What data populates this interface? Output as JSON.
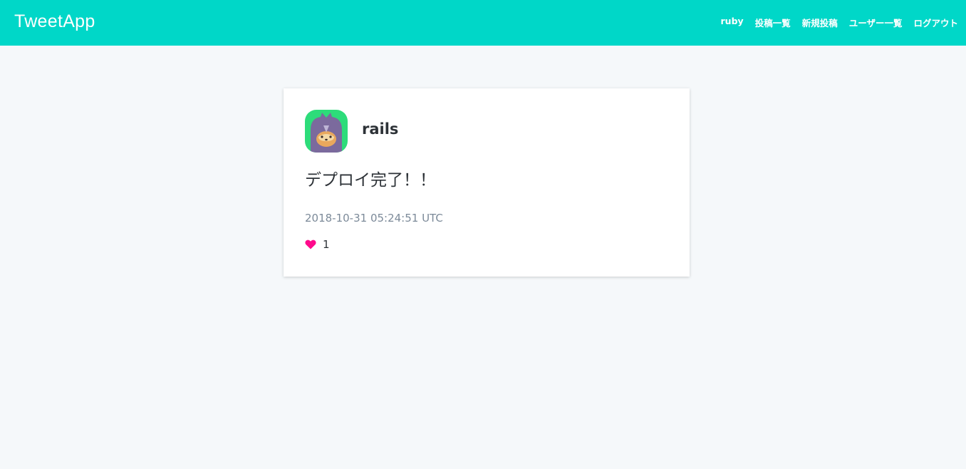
{
  "header": {
    "logo": "TweetApp",
    "nav": [
      "ruby",
      "投稿一覧",
      "新規投稿",
      "ユーザー一覧",
      "ログアウト"
    ]
  },
  "post": {
    "user": "rails",
    "content": "デプロイ完了！！",
    "timestamp": "2018-10-31 05:24:51 UTC",
    "likes": "1"
  },
  "colors": {
    "header": "#00d7c8",
    "background": "#f5f8fa",
    "like": "#ff0a8c",
    "avatar_bg": "#2ddc7a"
  },
  "icons": {
    "avatar": "cat-avatar",
    "like": "heart-icon"
  }
}
